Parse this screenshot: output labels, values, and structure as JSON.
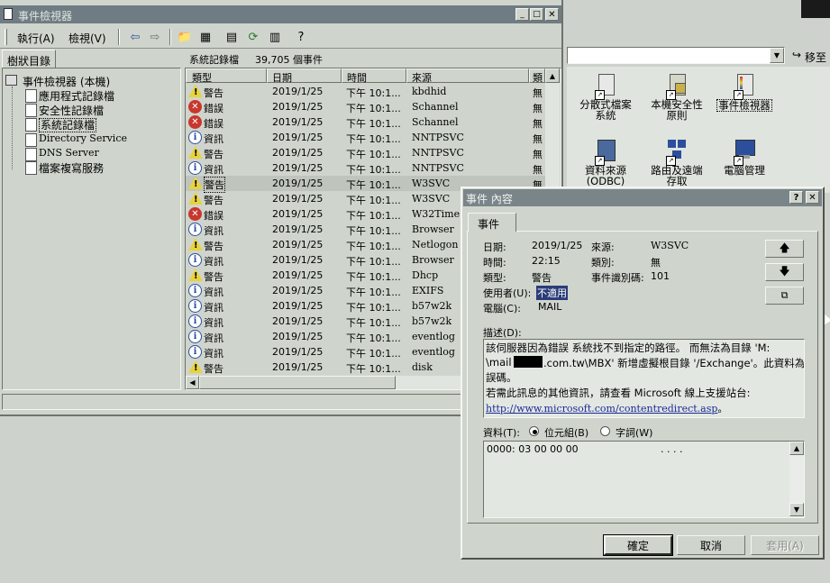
{
  "event_viewer": {
    "title": "事件檢視器",
    "menu": {
      "action": "執行(A)",
      "view": "檢視(V)"
    },
    "tree_tab": "樹狀目錄",
    "tree": {
      "root": "事件檢視器 (本機)",
      "items": [
        "應用程式記錄檔",
        "安全性記錄檔",
        "系統記錄檔",
        "Directory Service",
        "DNS Server",
        "檔案複寫服務"
      ]
    },
    "list_header": {
      "log_name": "系統記錄檔",
      "count": "39,705 個事件"
    },
    "columns": [
      "類型",
      "日期",
      "時間",
      "來源",
      "類"
    ],
    "rows": [
      {
        "type": "警告",
        "icon": "warning",
        "date": "2019/1/25",
        "time": "下午 10:1...",
        "source": "kbdhid",
        "cat": "無"
      },
      {
        "type": "錯誤",
        "icon": "error",
        "date": "2019/1/25",
        "time": "下午 10:1...",
        "source": "Schannel",
        "cat": "無"
      },
      {
        "type": "錯誤",
        "icon": "error",
        "date": "2019/1/25",
        "time": "下午 10:1...",
        "source": "Schannel",
        "cat": "無"
      },
      {
        "type": "資訊",
        "icon": "info",
        "date": "2019/1/25",
        "time": "下午 10:1...",
        "source": "NNTPSVC",
        "cat": "無"
      },
      {
        "type": "警告",
        "icon": "warning",
        "date": "2019/1/25",
        "time": "下午 10:1...",
        "source": "NNTPSVC",
        "cat": "無"
      },
      {
        "type": "資訊",
        "icon": "info",
        "date": "2019/1/25",
        "time": "下午 10:1...",
        "source": "NNTPSVC",
        "cat": "無"
      },
      {
        "type": "警告",
        "icon": "warning",
        "date": "2019/1/25",
        "time": "下午 10:1...",
        "source": "W3SVC",
        "cat": "無"
      },
      {
        "type": "警告",
        "icon": "warning",
        "date": "2019/1/25",
        "time": "下午 10:1...",
        "source": "W3SVC",
        "cat": ""
      },
      {
        "type": "錯誤",
        "icon": "error",
        "date": "2019/1/25",
        "time": "下午 10:1...",
        "source": "W32Time",
        "cat": ""
      },
      {
        "type": "資訊",
        "icon": "info",
        "date": "2019/1/25",
        "time": "下午 10:1...",
        "source": "Browser",
        "cat": ""
      },
      {
        "type": "警告",
        "icon": "warning",
        "date": "2019/1/25",
        "time": "下午 10:1...",
        "source": "Netlogon",
        "cat": ""
      },
      {
        "type": "資訊",
        "icon": "info",
        "date": "2019/1/25",
        "time": "下午 10:1...",
        "source": "Browser",
        "cat": ""
      },
      {
        "type": "警告",
        "icon": "warning",
        "date": "2019/1/25",
        "time": "下午 10:1...",
        "source": "Dhcp",
        "cat": ""
      },
      {
        "type": "資訊",
        "icon": "info",
        "date": "2019/1/25",
        "time": "下午 10:1...",
        "source": "EXIFS",
        "cat": ""
      },
      {
        "type": "資訊",
        "icon": "info",
        "date": "2019/1/25",
        "time": "下午 10:1...",
        "source": "b57w2k",
        "cat": ""
      },
      {
        "type": "資訊",
        "icon": "info",
        "date": "2019/1/25",
        "time": "下午 10:1...",
        "source": "b57w2k",
        "cat": ""
      },
      {
        "type": "資訊",
        "icon": "info",
        "date": "2019/1/25",
        "time": "下午 10:1...",
        "source": "eventlog",
        "cat": ""
      },
      {
        "type": "資訊",
        "icon": "info",
        "date": "2019/1/25",
        "time": "下午 10:1...",
        "source": "eventlog",
        "cat": ""
      },
      {
        "type": "警告",
        "icon": "warning",
        "date": "2019/1/25",
        "time": "下午 10:1...",
        "source": "disk",
        "cat": ""
      }
    ]
  },
  "background_window": {
    "go_label": "移至",
    "icons": [
      {
        "label": "分散式檔案\n系統",
        "icon": "dfs-icon"
      },
      {
        "label": "本機安全性\n原則",
        "icon": "security-policy-icon"
      },
      {
        "label": "事件檢視器",
        "icon": "event-viewer-icon"
      },
      {
        "label": "資料來源\n(ODBC)",
        "icon": "odbc-icon"
      },
      {
        "label": "路由及遠端\n存取",
        "icon": "routing-icon"
      },
      {
        "label": "電腦管理",
        "icon": "computer-management-icon"
      }
    ]
  },
  "dialog": {
    "title": "事件 內容",
    "tab": "事件",
    "fields": {
      "date_label": "日期:",
      "date": "2019/1/25",
      "source_label": "來源:",
      "source": "W3SVC",
      "time_label": "時間:",
      "time": "22:15",
      "category_label": "類別:",
      "category": "無",
      "type_label": "類型:",
      "type": "警告",
      "event_id_label": "事件識別碼:",
      "event_id": "101",
      "user_label": "使用者(U):",
      "user": "不適用",
      "computer_label": "電腦(C):",
      "computer": "MAIL"
    },
    "description_label": "描述(D):",
    "description": {
      "line1": "該伺服器因為錯誤 系統找不到指定的路徑。 而無法為目錄 'M:",
      "line2a": "\\mail",
      "line2b": ".com.tw\\MBX' 新增虛擬根目錄 '/Exchange'。此資料為錯",
      "line3": "誤碼。",
      "line4": "若需此訊息的其他資訊，請查看 Microsoft 線上支援站台:",
      "link": "http://www.microsoft.com/contentredirect.asp",
      "link_end": "。"
    },
    "data_label": "資料(T):",
    "data_bytes": "位元組(B)",
    "data_words": "字詞(W)",
    "data_content": "0000: 03 00 00 00",
    "data_dots": ". . . .",
    "ok": "確定",
    "cancel": "取消",
    "apply": "套用(A)"
  }
}
